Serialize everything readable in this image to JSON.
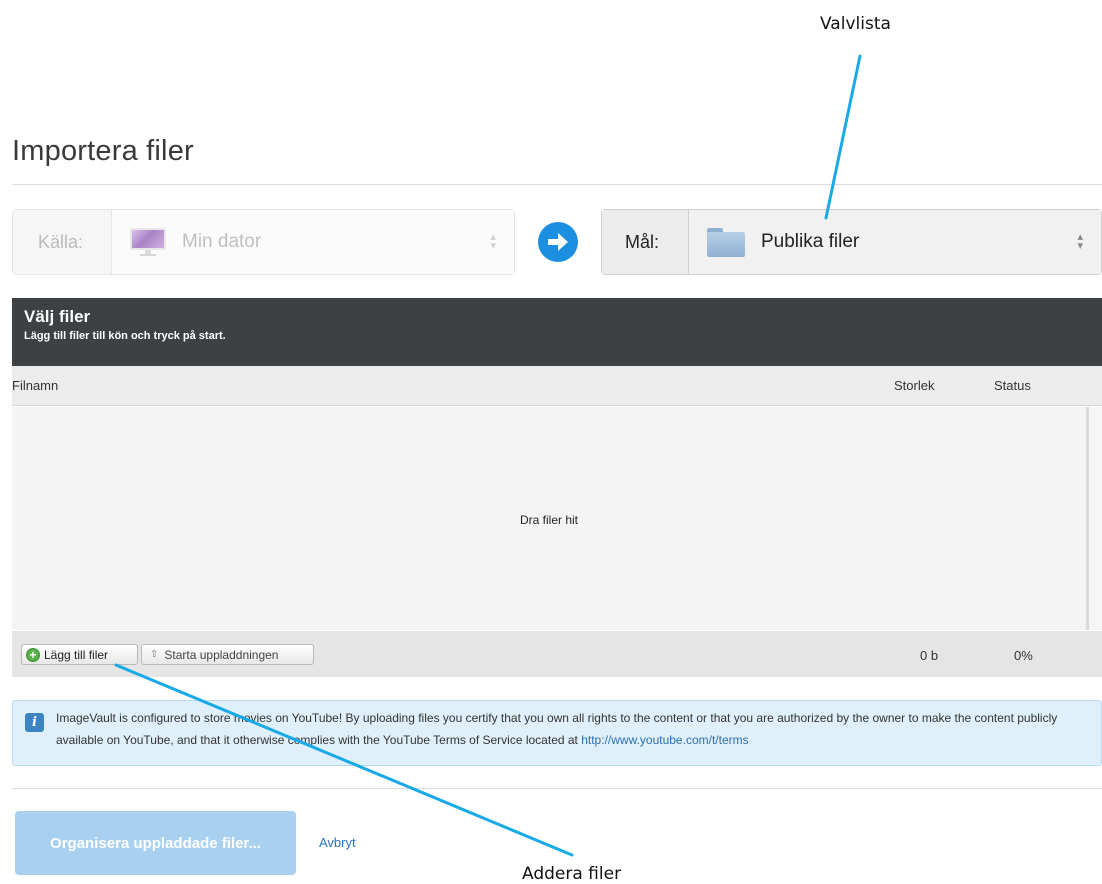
{
  "annotations": {
    "target_callout": "Valvlista",
    "add_callout": "Addera filer"
  },
  "page": {
    "title": "Importera filer"
  },
  "source": {
    "label": "Källa:",
    "value": "Min dator",
    "icon": "monitor-icon"
  },
  "target": {
    "label": "Mål:",
    "value": "Publika filer",
    "icon": "folder-icon"
  },
  "upload_panel": {
    "title": "Välj filer",
    "subtitle": "Lägg till filer till kön och tryck på start.",
    "columns": [
      "Filnamn",
      "Storlek",
      "Status"
    ],
    "drop_text": "Dra filer hit",
    "add_button": "Lägg till filer",
    "start_button": "Starta uppladdningen",
    "total_size": "0 b",
    "total_progress": "0%"
  },
  "info": {
    "text": "ImageVault is configured to store movies on YouTube! By uploading files you certify that you own all rights to the content or that you are authorized by the owner to make the content publicly available on YouTube, and that it otherwise complies with the YouTube Terms of Service located at ",
    "link": "http://www.youtube.com/t/terms"
  },
  "actions": {
    "organize_button": "Organisera uppladdade filer...",
    "cancel_link": "Avbryt"
  },
  "colors": {
    "accent_blue": "#1d8fe0",
    "header_dark": "#3e4144",
    "callout_line": "#1aa9e8",
    "info_bg": "#dff0fb",
    "primary_disabled": "#a9d0ef"
  }
}
